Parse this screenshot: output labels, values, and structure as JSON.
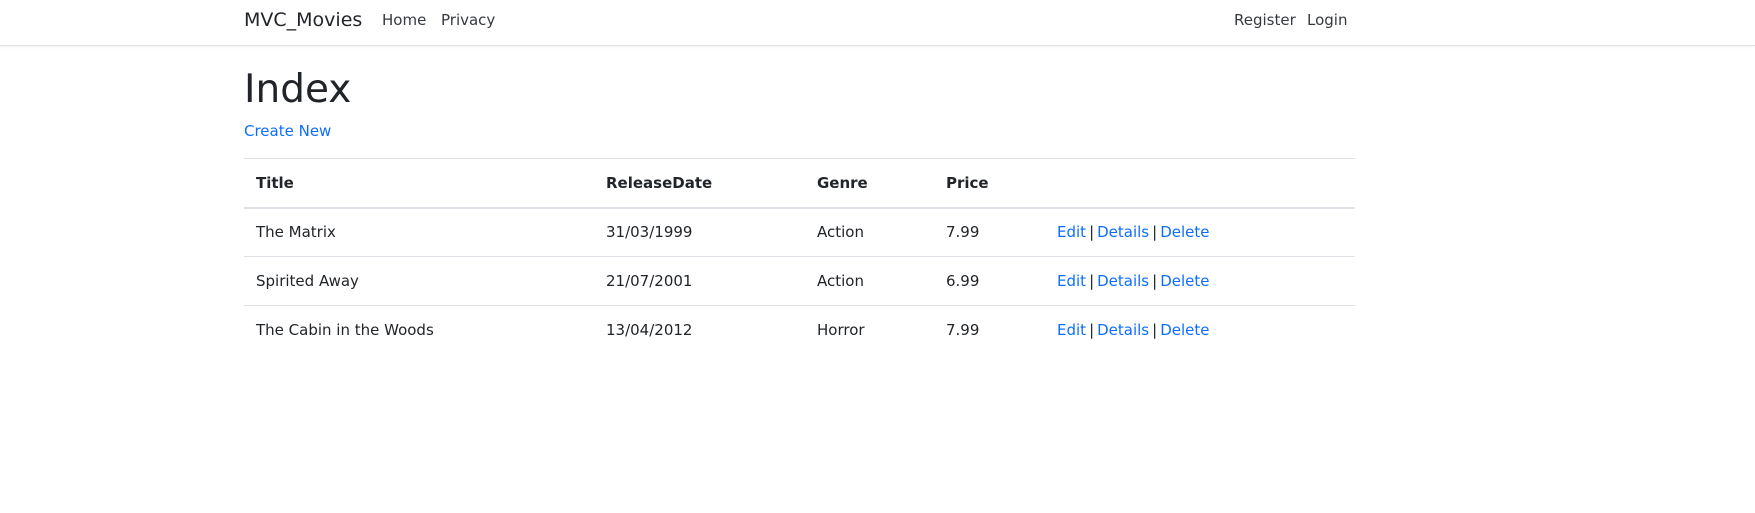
{
  "navbar": {
    "brand": "MVC_Movies",
    "links": [
      "Home",
      "Privacy"
    ],
    "right_links": [
      "Register",
      "Login"
    ]
  },
  "page": {
    "title": "Index",
    "create_new": "Create New"
  },
  "table": {
    "headers": [
      "Title",
      "ReleaseDate",
      "Genre",
      "Price",
      ""
    ],
    "rows": [
      {
        "title": "The Matrix",
        "release_date": "31/03/1999",
        "genre": "Action",
        "price": "7.99"
      },
      {
        "title": "Spirited Away",
        "release_date": "21/07/2001",
        "genre": "Action",
        "price": "6.99"
      },
      {
        "title": "The Cabin in the Woods",
        "release_date": "13/04/2012",
        "genre": "Horror",
        "price": "7.99"
      }
    ],
    "actions": {
      "edit": "Edit",
      "details": "Details",
      "delete": "Delete",
      "separator": "|"
    }
  },
  "colors": {
    "link": "#0d6efd",
    "text": "#212529",
    "border": "#dee2e6"
  }
}
